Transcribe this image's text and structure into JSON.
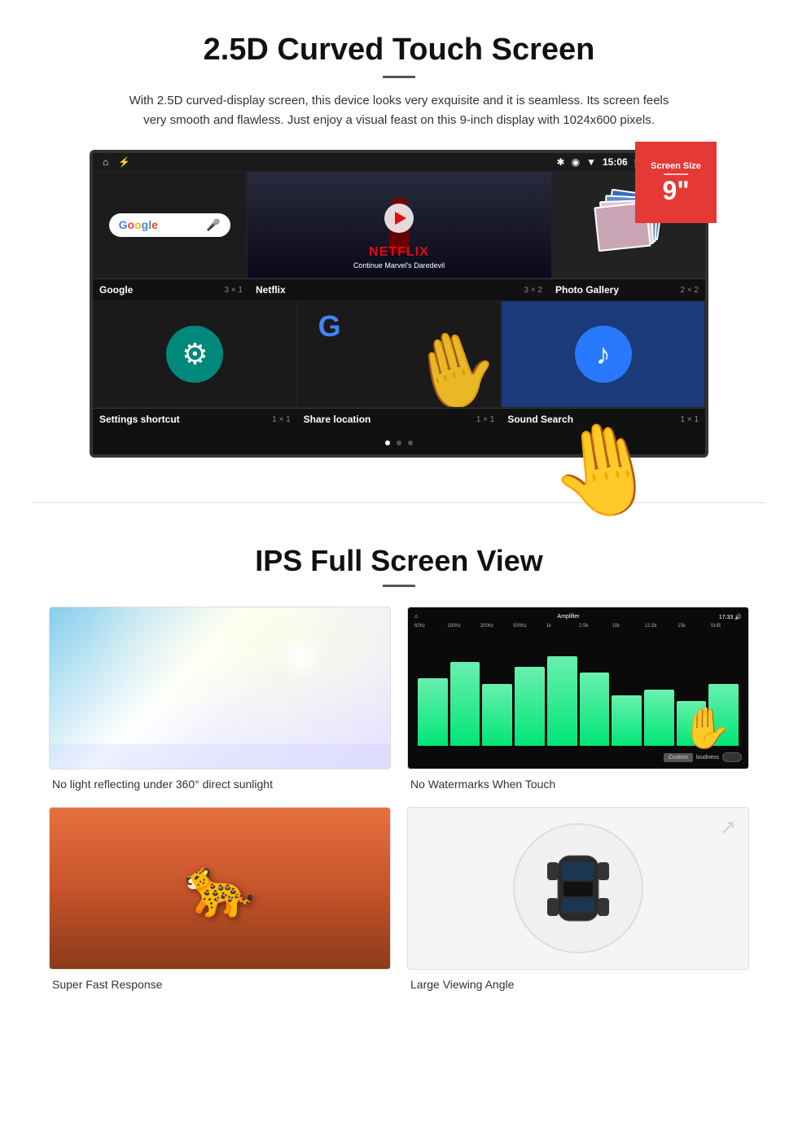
{
  "section1": {
    "title": "2.5D Curved Touch Screen",
    "description": "With 2.5D curved-display screen, this device looks very exquisite and it is seamless. Its screen feels very smooth and flawless. Just enjoy a visual feast on this 9-inch display with 1024x600 pixels.",
    "screen_size_badge": {
      "label": "Screen Size",
      "value": "9\""
    },
    "status_bar": {
      "time": "15:06",
      "icons_left": [
        "home",
        "usb"
      ],
      "icons_right": [
        "bluetooth",
        "location",
        "wifi",
        "camera",
        "volume",
        "close",
        "window"
      ]
    },
    "app_rows": [
      {
        "cells": [
          {
            "name": "Google",
            "size": "3 × 1",
            "type": "google"
          },
          {
            "name": "Netflix",
            "size": "3 × 2",
            "type": "netflix",
            "wide": true,
            "netflix_text": "NETFLIX",
            "netflix_sub": "Continue Marvel's Daredevil"
          },
          {
            "name": "Photo Gallery",
            "size": "2 × 2",
            "type": "photo"
          }
        ]
      },
      {
        "cells": [
          {
            "name": "Settings shortcut",
            "size": "1 × 1",
            "type": "settings"
          },
          {
            "name": "Share location",
            "size": "1 × 1",
            "type": "share"
          },
          {
            "name": "Sound Search",
            "size": "1 × 1",
            "type": "sound"
          }
        ]
      }
    ]
  },
  "section2": {
    "title": "IPS Full Screen View",
    "features": [
      {
        "id": "no-reflection",
        "label": "No light reflecting under 360° direct sunlight",
        "image_type": "sky"
      },
      {
        "id": "no-watermarks",
        "label": "No Watermarks When Touch",
        "image_type": "amplifier"
      },
      {
        "id": "fast-response",
        "label": "Super Fast Response",
        "image_type": "cheetah"
      },
      {
        "id": "large-view",
        "label": "Large Viewing Angle",
        "image_type": "car"
      }
    ]
  }
}
